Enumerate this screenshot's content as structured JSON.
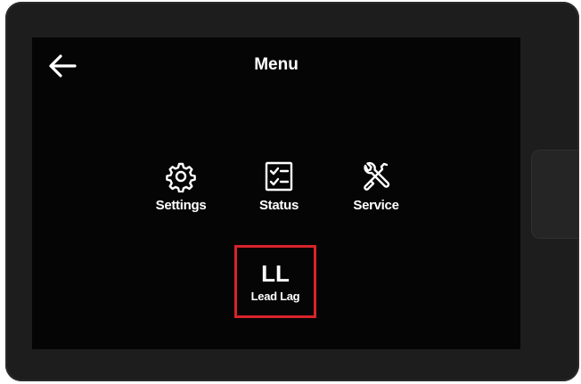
{
  "menu": {
    "title": "Menu",
    "back_icon": "arrow-left-icon",
    "items": [
      {
        "label": "Settings",
        "icon": "gear-icon"
      },
      {
        "label": "Status",
        "icon": "checklist-icon"
      },
      {
        "label": "Service",
        "icon": "tools-icon"
      },
      {
        "short": "LL",
        "label": "Lead Lag",
        "highlighted": true
      }
    ]
  },
  "colors": {
    "screen_bg": "#050505",
    "text": "#ffffff",
    "highlight": "#d8232a"
  }
}
